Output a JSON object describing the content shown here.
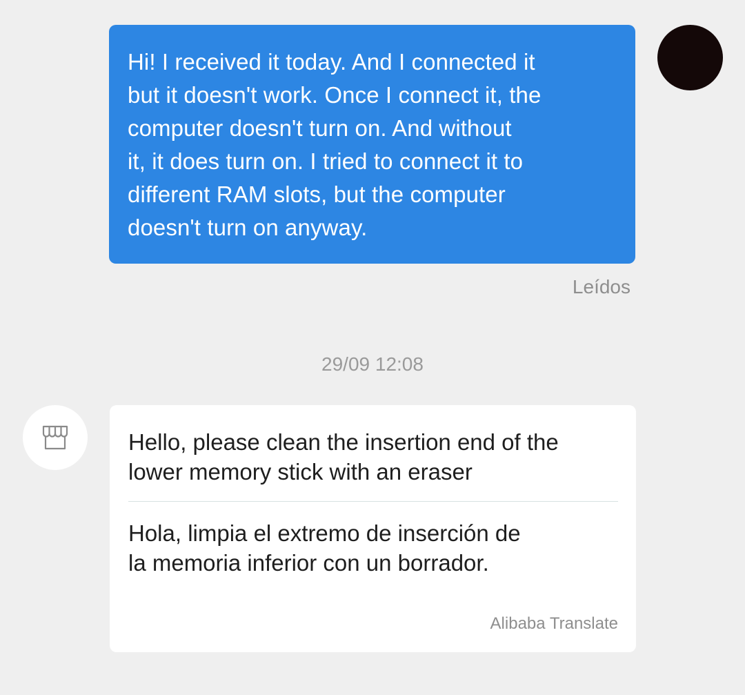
{
  "outgoing_message": {
    "lines": [
      "Hi! I received it today. And I connected it",
      "but it doesn't work. Once I connect it, the",
      "computer doesn't turn on. And without",
      "it, it does turn on. I tried to connect it to",
      "different RAM slots, but the computer",
      "doesn't turn on anyway."
    ],
    "status": "Leídos",
    "bubble_color": "#2d86e3"
  },
  "timestamp": "29/09 12:08",
  "incoming_message": {
    "avatar_icon": "storefront-icon",
    "original_lines": [
      "Hello, please clean the insertion end of the",
      "lower memory stick with an eraser"
    ],
    "translated_lines": [
      "Hola, limpia el extremo de inserción de",
      "la memoria inferior con un borrador."
    ],
    "translation_credit": "Alibaba Translate"
  }
}
